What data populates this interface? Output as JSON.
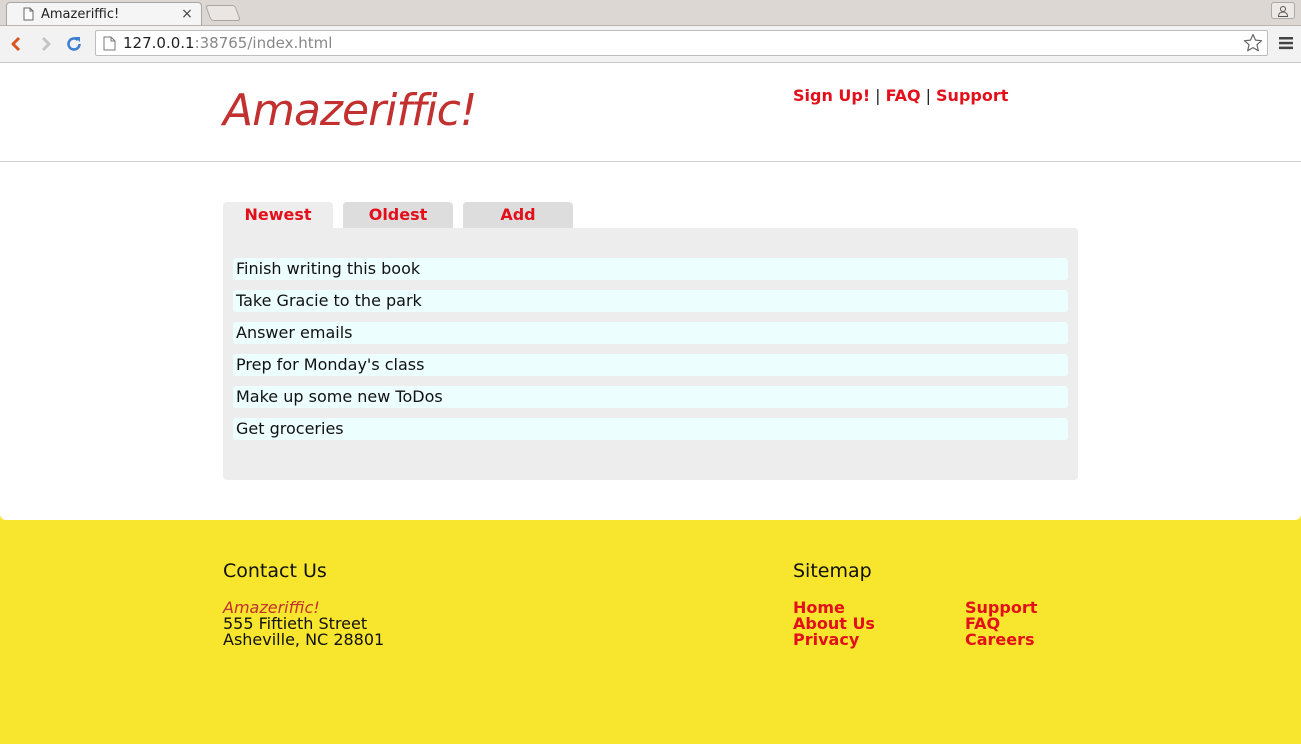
{
  "browser": {
    "tab_title": "Amazeriffic!",
    "tab_close": "×",
    "url_host": "127.0.0.1",
    "url_rest": ":38765/index.html"
  },
  "header": {
    "logo": "Amazeriffic!",
    "nav": [
      {
        "label": "Sign Up!"
      },
      {
        "label": "FAQ"
      },
      {
        "label": "Support"
      }
    ],
    "separator": "|"
  },
  "main": {
    "tabs": [
      {
        "label": "Newest",
        "active": true
      },
      {
        "label": "Oldest",
        "active": false
      },
      {
        "label": "Add",
        "active": false
      }
    ],
    "todos": [
      "Finish writing this book",
      "Take Gracie to the park",
      "Answer emails",
      "Prep for Monday's class",
      "Make up some new ToDos",
      "Get groceries"
    ]
  },
  "footer": {
    "contact": {
      "heading": "Contact Us",
      "name": "Amazeriffic!",
      "street": "555 Fiftieth Street",
      "city": "Asheville, NC 28801"
    },
    "sitemap": {
      "heading": "Sitemap",
      "col1": [
        "Home",
        "About Us",
        "Privacy"
      ],
      "col2": [
        "Support",
        "FAQ",
        "Careers"
      ]
    }
  },
  "colors": {
    "accent_red": "#e3101b",
    "logo_red": "#c2302f",
    "footer_yellow": "#f8e62e",
    "todo_bg": "#edfefe",
    "panel_gray": "#ededed"
  }
}
